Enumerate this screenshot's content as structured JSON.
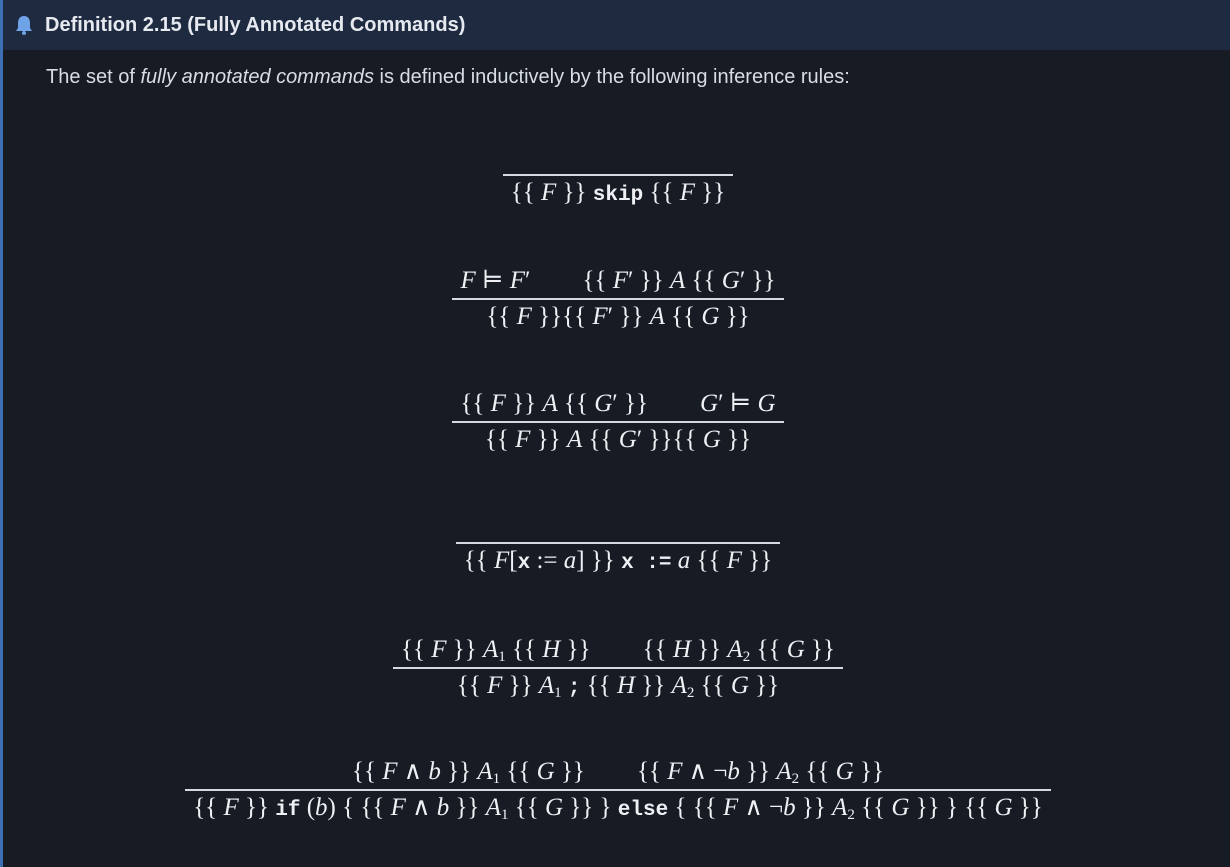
{
  "header": {
    "icon": "bell-icon",
    "title": "Definition 2.15 (Fully Annotated Commands)",
    "accent_color": "#3d6fb4",
    "header_bg": "#1e2a40"
  },
  "intro": {
    "prefix": "The set of ",
    "emphasis": "fully annotated commands",
    "suffix": " is defined inductively by the following inference rules:"
  },
  "rules": {
    "skip": {
      "premise": "",
      "conclusion": "{{ F }} skip {{ F }}"
    },
    "strengthen": {
      "premise_1": "F ⊨ F′",
      "premise_2": "{{ F′ }} A {{ G′ }}",
      "conclusion": "{{ F }}{{ F′ }} A {{ G }}"
    },
    "weaken": {
      "premise_1": "{{ F }} A {{ G′ }}",
      "premise_2": "G′ ⊨ G",
      "conclusion": "{{ F }} A {{ G′ }}{{ G }}"
    },
    "assign": {
      "premise": "",
      "conclusion": "{{ F[x := a] }} x := a {{ F }}"
    },
    "seq": {
      "premise_1": "{{ F }} A1 {{ H }}",
      "premise_2": "{{ H }} A2 {{ G }}",
      "conclusion": "{{ F }} A1 ; {{ H }} A2 {{ G }}"
    },
    "if": {
      "premise_1": "{{ F ∧ b }} A1 {{ G }}",
      "premise_2": "{{ F ∧ ¬b }} A2 {{ G }}",
      "conclusion": "{{ F }} if (b) { {{ F ∧ b }} A1 {{ G }} } else { {{ F ∧ ¬b }} A2 {{ G }} } {{ G }}"
    }
  }
}
